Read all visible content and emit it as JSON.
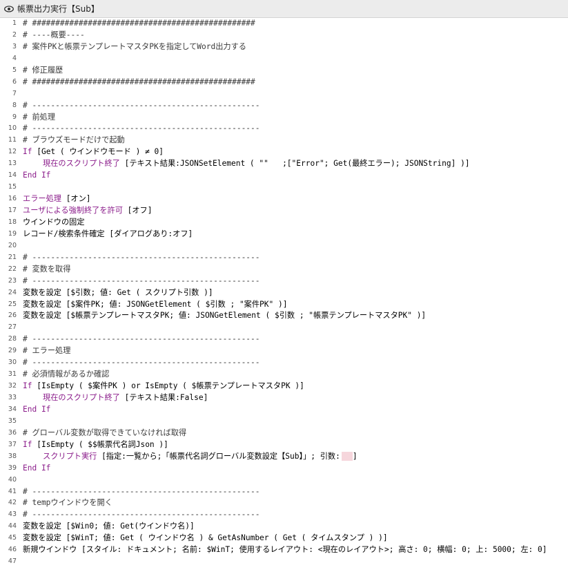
{
  "window": {
    "title": "帳票出力実行【Sub】",
    "icon": "eye-icon"
  },
  "colors": {
    "keyword": "#8b1d8b",
    "comment": "#3a3a3a",
    "plain": "#000000",
    "empty_param": "#f6d6dc"
  },
  "lines": [
    {
      "n": "1",
      "indent": 0,
      "segs": [
        {
          "t": "c",
          "v": "# ################################################"
        }
      ]
    },
    {
      "n": "2",
      "indent": 0,
      "segs": [
        {
          "t": "c",
          "v": "# ----概要----"
        }
      ]
    },
    {
      "n": "3",
      "indent": 0,
      "segs": [
        {
          "t": "c",
          "v": "# 案件PKと帳票テンプレートマスタPKを指定してWord出力する"
        }
      ]
    },
    {
      "n": "4",
      "indent": 0,
      "segs": []
    },
    {
      "n": "5",
      "indent": 0,
      "segs": [
        {
          "t": "c",
          "v": "# 修正履歴"
        }
      ]
    },
    {
      "n": "6",
      "indent": 0,
      "segs": [
        {
          "t": "c",
          "v": "# ################################################"
        }
      ]
    },
    {
      "n": "7",
      "indent": 0,
      "segs": []
    },
    {
      "n": "8",
      "indent": 0,
      "segs": [
        {
          "t": "c",
          "v": "# -------------------------------------------------"
        }
      ]
    },
    {
      "n": "9",
      "indent": 0,
      "segs": [
        {
          "t": "c",
          "v": "# 前処理"
        }
      ]
    },
    {
      "n": "10",
      "indent": 0,
      "segs": [
        {
          "t": "c",
          "v": "# -------------------------------------------------"
        }
      ]
    },
    {
      "n": "11",
      "indent": 0,
      "segs": [
        {
          "t": "c",
          "v": "# ブラウズモードだけで起動"
        }
      ]
    },
    {
      "n": "12",
      "indent": 0,
      "segs": [
        {
          "t": "k",
          "v": "If"
        },
        {
          "t": "p",
          "v": " [Get ( ウインドウモード ) ≠ 0]"
        }
      ]
    },
    {
      "n": "13",
      "indent": 1,
      "segs": [
        {
          "t": "k",
          "v": "現在のスクリプト終了"
        },
        {
          "t": "p",
          "v": " [テキスト結果:JSONSetElement ( \"\"   ;[\"Error\"; Get(最終エラー); JSONString] )]"
        }
      ]
    },
    {
      "n": "14",
      "indent": 0,
      "segs": [
        {
          "t": "k",
          "v": "End If"
        }
      ]
    },
    {
      "n": "15",
      "indent": 0,
      "segs": []
    },
    {
      "n": "16",
      "indent": 0,
      "segs": [
        {
          "t": "k",
          "v": "エラー処理"
        },
        {
          "t": "p",
          "v": " [オン]"
        }
      ]
    },
    {
      "n": "17",
      "indent": 0,
      "segs": [
        {
          "t": "k",
          "v": "ユーザによる強制終了を許可"
        },
        {
          "t": "p",
          "v": " [オフ]"
        }
      ]
    },
    {
      "n": "18",
      "indent": 0,
      "segs": [
        {
          "t": "p",
          "v": "ウインドウの固定"
        }
      ]
    },
    {
      "n": "19",
      "indent": 0,
      "segs": [
        {
          "t": "p",
          "v": "レコード/検索条件確定 [ダイアログあり:オフ]"
        }
      ]
    },
    {
      "n": "20",
      "indent": 0,
      "segs": []
    },
    {
      "n": "21",
      "indent": 0,
      "segs": [
        {
          "t": "c",
          "v": "# -------------------------------------------------"
        }
      ]
    },
    {
      "n": "22",
      "indent": 0,
      "segs": [
        {
          "t": "c",
          "v": "# 変数を取得"
        }
      ]
    },
    {
      "n": "23",
      "indent": 0,
      "segs": [
        {
          "t": "c",
          "v": "# -------------------------------------------------"
        }
      ]
    },
    {
      "n": "24",
      "indent": 0,
      "segs": [
        {
          "t": "p",
          "v": "変数を設定 [$引数; 値: Get ( スクリプト引数 )]"
        }
      ]
    },
    {
      "n": "25",
      "indent": 0,
      "segs": [
        {
          "t": "p",
          "v": "変数を設定 [$案件PK; 値: JSONGetElement ( $引数 ; \"案件PK\" )]"
        }
      ]
    },
    {
      "n": "26",
      "indent": 0,
      "segs": [
        {
          "t": "p",
          "v": "変数を設定 [$帳票テンプレートマスタPK; 値: JSONGetElement ( $引数 ; \"帳票テンプレートマスタPK\" )]"
        }
      ]
    },
    {
      "n": "27",
      "indent": 0,
      "segs": []
    },
    {
      "n": "28",
      "indent": 0,
      "segs": [
        {
          "t": "c",
          "v": "# -------------------------------------------------"
        }
      ]
    },
    {
      "n": "29",
      "indent": 0,
      "segs": [
        {
          "t": "c",
          "v": "# エラー処理"
        }
      ]
    },
    {
      "n": "30",
      "indent": 0,
      "segs": [
        {
          "t": "c",
          "v": "# -------------------------------------------------"
        }
      ]
    },
    {
      "n": "31",
      "indent": 0,
      "segs": [
        {
          "t": "c",
          "v": "# 必須情報があるか確認"
        }
      ]
    },
    {
      "n": "32",
      "indent": 0,
      "segs": [
        {
          "t": "k",
          "v": "If"
        },
        {
          "t": "p",
          "v": " [IsEmpty ( $案件PK ) or IsEmpty ( $帳票テンプレートマスタPK )]"
        }
      ]
    },
    {
      "n": "33",
      "indent": 1,
      "segs": [
        {
          "t": "k",
          "v": "現在のスクリプト終了"
        },
        {
          "t": "p",
          "v": " [テキスト結果:False]"
        }
      ]
    },
    {
      "n": "34",
      "indent": 0,
      "segs": [
        {
          "t": "k",
          "v": "End If"
        }
      ]
    },
    {
      "n": "35",
      "indent": 0,
      "segs": []
    },
    {
      "n": "36",
      "indent": 0,
      "segs": [
        {
          "t": "c",
          "v": "# グローバル変数が取得できていなければ取得"
        }
      ]
    },
    {
      "n": "37",
      "indent": 0,
      "segs": [
        {
          "t": "k",
          "v": "If"
        },
        {
          "t": "p",
          "v": " [IsEmpty ( $$帳票代名詞Json )]"
        }
      ]
    },
    {
      "n": "38",
      "indent": 1,
      "segs": [
        {
          "t": "k",
          "v": "スクリプト実行"
        },
        {
          "t": "p",
          "v": " [指定:一覧から;「帳票代名詞グローバル変数設定【Sub】」; 引数:"
        },
        {
          "t": "empty",
          "v": ""
        },
        {
          "t": "p",
          "v": "]"
        }
      ]
    },
    {
      "n": "39",
      "indent": 0,
      "segs": [
        {
          "t": "k",
          "v": "End If"
        }
      ]
    },
    {
      "n": "40",
      "indent": 0,
      "segs": []
    },
    {
      "n": "41",
      "indent": 0,
      "segs": [
        {
          "t": "c",
          "v": "# -------------------------------------------------"
        }
      ]
    },
    {
      "n": "42",
      "indent": 0,
      "segs": [
        {
          "t": "c",
          "v": "# tempウインドウを開く"
        }
      ]
    },
    {
      "n": "43",
      "indent": 0,
      "segs": [
        {
          "t": "c",
          "v": "# -------------------------------------------------"
        }
      ]
    },
    {
      "n": "44",
      "indent": 0,
      "segs": [
        {
          "t": "p",
          "v": "変数を設定 [$Win0; 値: Get(ウインドウ名)]"
        }
      ]
    },
    {
      "n": "45",
      "indent": 0,
      "segs": [
        {
          "t": "p",
          "v": "変数を設定 [$WinT; 値: Get ( ウインドウ名 ) & GetAsNumber ( Get ( タイムスタンプ ) )]"
        }
      ]
    },
    {
      "n": "46",
      "indent": 0,
      "segs": [
        {
          "t": "p",
          "v": "新規ウインドウ [スタイル: ドキュメント; 名前: $WinT; 使用するレイアウト: <現在のレイアウト>; 高さ: 0; 横幅: 0; 上: 5000; 左: 0]"
        }
      ]
    },
    {
      "n": "47",
      "indent": 0,
      "segs": []
    }
  ]
}
